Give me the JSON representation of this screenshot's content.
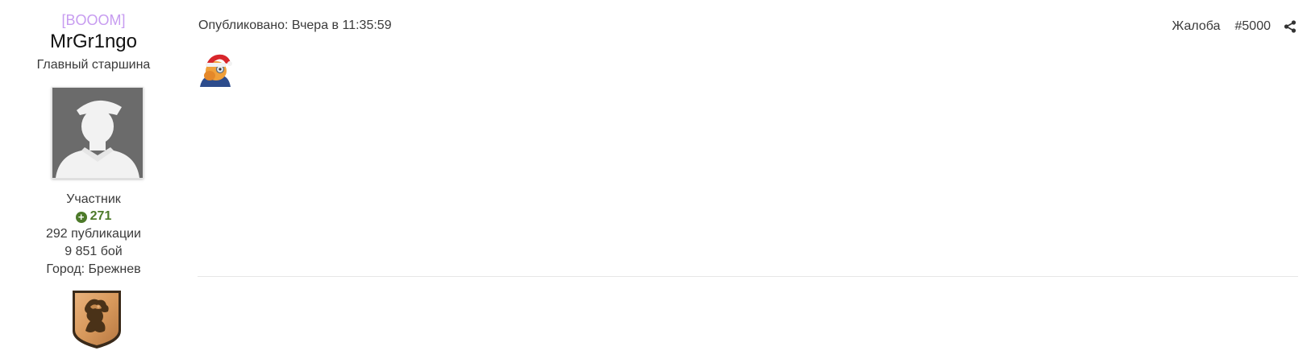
{
  "author": {
    "clan_tag": "[BOOOM]",
    "username": "MrGr1ngo",
    "rank": "Главный старшина",
    "avatar_icon": "user-silhouette-icon",
    "group": "Участник",
    "reputation": "271",
    "posts": "292 публикации",
    "battles": "9 851 бой",
    "city": "Город: Брежнев",
    "clan_emblem_icon": "lion-shield-icon"
  },
  "post": {
    "published": "Опубликовано: Вчера в 11:35:59",
    "report_label": "Жалоба",
    "post_number": "#5000",
    "share_icon": "share-icon",
    "content_emoticon": "santa-hat-emoticon"
  },
  "colors": {
    "clan_tag": "#c79cf0",
    "reputation": "#4d7a2a",
    "avatar_bg": "#6b6b6b"
  }
}
